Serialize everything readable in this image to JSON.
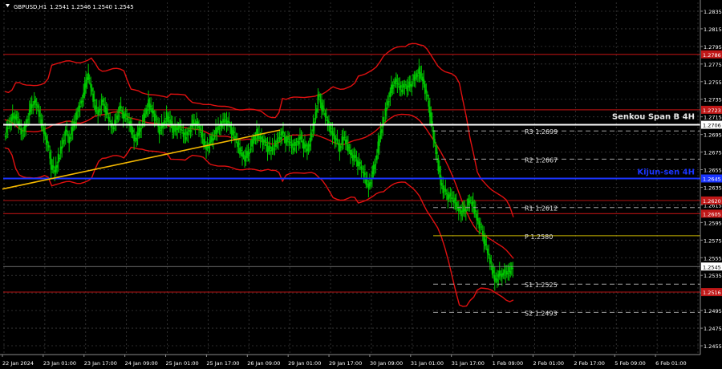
{
  "header": {
    "symbol": "GBPUSD,H1",
    "ohlc": "1.2541  1.2546  1.2540  1.2545"
  },
  "colors": {
    "background": "#000000",
    "grid": "#3a3a3a",
    "candle": "#00c800",
    "channel": "#e01010",
    "trendline": "#f5b800",
    "kijun": "#1a35ff",
    "senkou": "#ffffff",
    "resistance_line": "#a01010",
    "pivot": "#c8b400",
    "text": "#ffffff"
  },
  "chart_data": {
    "type": "candlestick",
    "ylim": [
      1.2445,
      1.2845
    ],
    "y_ticks": [
      "1.2835",
      "1.2815",
      "1.2795",
      "1.2775",
      "1.2755",
      "1.2735",
      "1.2715",
      "1.2695",
      "1.2675",
      "1.2655",
      "1.2635",
      "1.2615",
      "1.2595",
      "1.2575",
      "1.2555",
      "1.2535",
      "1.2515",
      "1.2495",
      "1.2475",
      "1.2455"
    ],
    "x_ticks": [
      "22 Jan 2024",
      "23 Jan 01:00",
      "23 Jan 17:00",
      "24 Jan 09:00",
      "25 Jan 01:00",
      "25 Jan 17:00",
      "26 Jan 09:00",
      "29 Jan 01:00",
      "29 Jan 17:00",
      "30 Jan 09:00",
      "31 Jan 01:00",
      "31 Jan 17:00",
      "1 Feb 09:00",
      "2 Feb 01:00",
      "2 Feb 17:00",
      "5 Feb 09:00",
      "6 Feb 01:00"
    ],
    "price_path": [
      1.2693,
      1.2705,
      1.2712,
      1.2718,
      1.2706,
      1.2694,
      1.2708,
      1.2721,
      1.2733,
      1.2728,
      1.2712,
      1.2698,
      1.2683,
      1.266,
      1.2652,
      1.2668,
      1.2684,
      1.2698,
      1.269,
      1.2703,
      1.2716,
      1.273,
      1.274,
      1.2765,
      1.2748,
      1.2728,
      1.272,
      1.2732,
      1.2725,
      1.271,
      1.2703,
      1.2712,
      1.2725,
      1.2718,
      1.2712,
      1.2705,
      1.269,
      1.2694,
      1.2706,
      1.2718,
      1.273,
      1.2722,
      1.2712,
      1.27,
      1.2705,
      1.2716,
      1.271,
      1.2698,
      1.2705,
      1.27,
      1.2692,
      1.2698,
      1.2705,
      1.271,
      1.2702,
      1.269,
      1.268,
      1.2686,
      1.2693,
      1.27,
      1.2706,
      1.2712,
      1.2708,
      1.27,
      1.269,
      1.268,
      1.2672,
      1.2668,
      1.2678,
      1.2688,
      1.2696,
      1.2692,
      1.2686,
      1.268,
      1.2676,
      1.2684,
      1.269,
      1.2696,
      1.269,
      1.2686,
      1.268,
      1.2686,
      1.269,
      1.2684,
      1.2676,
      1.2692,
      1.2712,
      1.2738,
      1.2728,
      1.2715,
      1.2705,
      1.2696,
      1.2688,
      1.268,
      1.2692,
      1.2684,
      1.2674,
      1.2668,
      1.2664,
      1.2656,
      1.2646,
      1.2636,
      1.265,
      1.2666,
      1.269,
      1.271,
      1.2728,
      1.2742,
      1.2756,
      1.2752,
      1.2746,
      1.2752,
      1.2748,
      1.2754,
      1.276,
      1.2766,
      1.2758,
      1.274,
      1.272,
      1.269,
      1.2668,
      1.264,
      1.263,
      1.2626,
      1.2622,
      1.2618,
      1.261,
      1.2606,
      1.2612,
      1.262,
      1.2614,
      1.26,
      1.259,
      1.2576,
      1.256,
      1.2546,
      1.253,
      1.2534,
      1.2538,
      1.2536,
      1.254,
      1.2545
    ],
    "kijun_sen": {
      "value": 1.2645,
      "label": "Kijun-sen 4H"
    },
    "senkou_span_b": {
      "value": 1.2706,
      "label": "Senkou Span B 4H"
    },
    "pivot_levels": [
      {
        "name": "R3",
        "value": 1.2699,
        "label": "R3  1.2699"
      },
      {
        "name": "R2",
        "value": 1.2667,
        "label": "R2  1.2667"
      },
      {
        "name": "R1",
        "value": 1.2612,
        "label": "R1  1.2612"
      },
      {
        "name": "P",
        "value": 1.258,
        "label": "P  1.2580"
      },
      {
        "name": "S1",
        "value": 1.2525,
        "label": "S1  1.2525"
      },
      {
        "name": "S2",
        "value": 1.2493,
        "label": "S2  1.2493"
      }
    ],
    "horizontal_levels": [
      1.2786,
      1.2723,
      1.262,
      1.2605,
      1.2516
    ],
    "trendline": {
      "from": 1.2633,
      "to": 1.27
    },
    "current_price": {
      "value": 1.2545,
      "label": "1.2545"
    },
    "axis_price_labels": [
      {
        "value": 1.2786,
        "label": "1.2786",
        "kind": "red"
      },
      {
        "value": 1.2723,
        "label": "1.2723",
        "kind": "red"
      },
      {
        "value": 1.2706,
        "label": "1.2706",
        "kind": "white"
      },
      {
        "value": 1.2645,
        "label": "1.2645",
        "kind": "blue"
      },
      {
        "value": 1.262,
        "label": "1.2620",
        "kind": "red"
      },
      {
        "value": 1.2605,
        "label": "1.2605",
        "kind": "red"
      },
      {
        "value": 1.2545,
        "label": "1.2545",
        "kind": "current"
      },
      {
        "value": 1.2516,
        "label": "1.2516",
        "kind": "red"
      }
    ]
  }
}
